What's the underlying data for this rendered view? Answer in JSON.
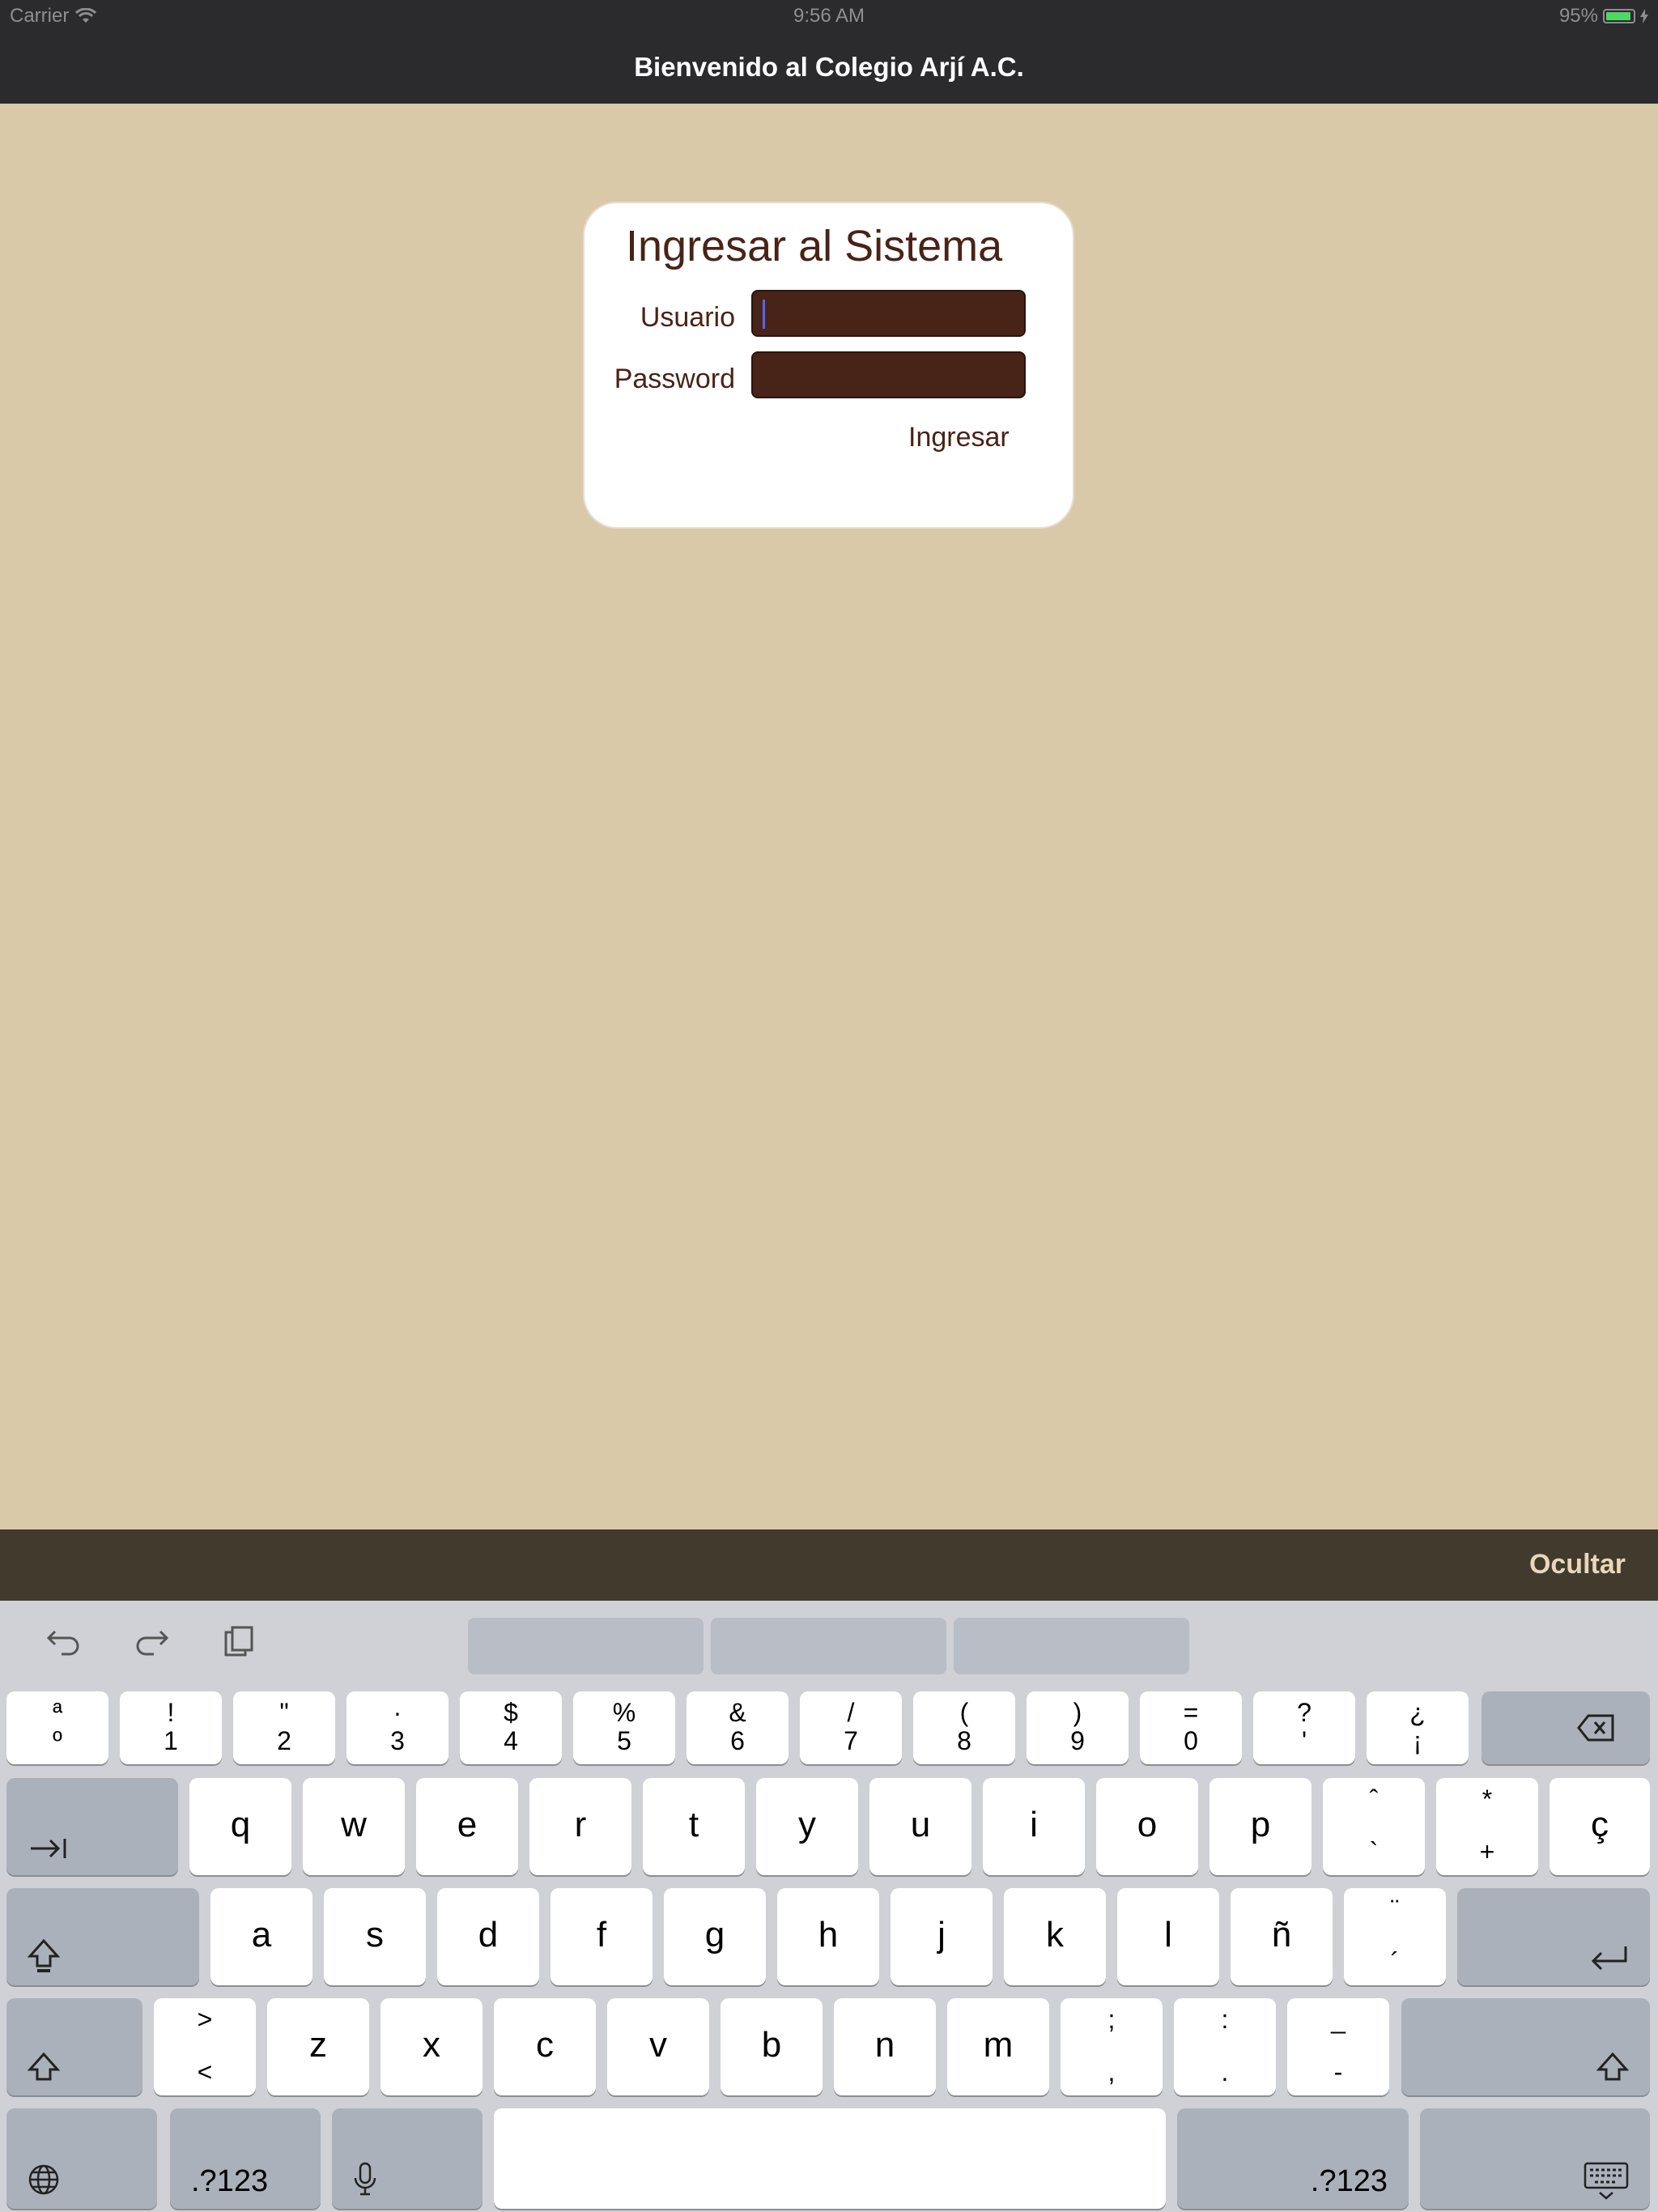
{
  "status_bar": {
    "carrier": "Carrier",
    "time": "9:56 AM",
    "battery": "95%",
    "battery_level": 0.95
  },
  "nav": {
    "title": "Bienvenido al Colegio Arjí A.C."
  },
  "login": {
    "heading": "Ingresar al Sistema",
    "usuario_label": "Usuario",
    "usuario_value": "",
    "password_label": "Password",
    "password_value": "",
    "submit_label": "Ingresar"
  },
  "accessory": {
    "hide_label": "Ocultar"
  },
  "keyboard": {
    "row1": [
      {
        "top": "ª",
        "bottom": "º"
      },
      {
        "top": "!",
        "bottom": "1"
      },
      {
        "top": "\"",
        "bottom": "2"
      },
      {
        "top": "·",
        "bottom": "3"
      },
      {
        "top": "$",
        "bottom": "4"
      },
      {
        "top": "%",
        "bottom": "5"
      },
      {
        "top": "&",
        "bottom": "6"
      },
      {
        "top": "/",
        "bottom": "7"
      },
      {
        "top": "(",
        "bottom": "8"
      },
      {
        "top": ")",
        "bottom": "9"
      },
      {
        "top": "=",
        "bottom": "0"
      },
      {
        "top": "?",
        "bottom": "'"
      },
      {
        "top": "¿",
        "bottom": "¡"
      }
    ],
    "row2": [
      "q",
      "w",
      "e",
      "r",
      "t",
      "y",
      "u",
      "i",
      "o",
      "p"
    ],
    "row2_extra": [
      {
        "top": "ˆ",
        "bottom": "`"
      },
      {
        "top": "*",
        "bottom": "+"
      }
    ],
    "row2_last": "ç",
    "row3": [
      "a",
      "s",
      "d",
      "f",
      "g",
      "h",
      "j",
      "k",
      "l",
      "ñ"
    ],
    "row3_extra": {
      "top": "¨",
      "bottom": "´"
    },
    "row4_first": {
      "top": ">",
      "bottom": "<"
    },
    "row4": [
      "z",
      "x",
      "c",
      "v",
      "b",
      "n",
      "m"
    ],
    "row4_extra": [
      {
        "top": ";",
        "bottom": ","
      },
      {
        "top": ":",
        "bottom": "."
      },
      {
        "top": "_",
        "bottom": "-"
      }
    ],
    "numbers_label": ".?123",
    "icons": {
      "undo": "undo-icon",
      "redo": "redo-icon",
      "paste": "paste-icon",
      "backspace": "backspace-icon",
      "tab": "tab-icon",
      "shift": "shift-icon",
      "return": "return-icon",
      "globe": "globe-icon",
      "mic": "microphone-icon",
      "dismiss": "keyboard-dismiss-icon"
    }
  }
}
